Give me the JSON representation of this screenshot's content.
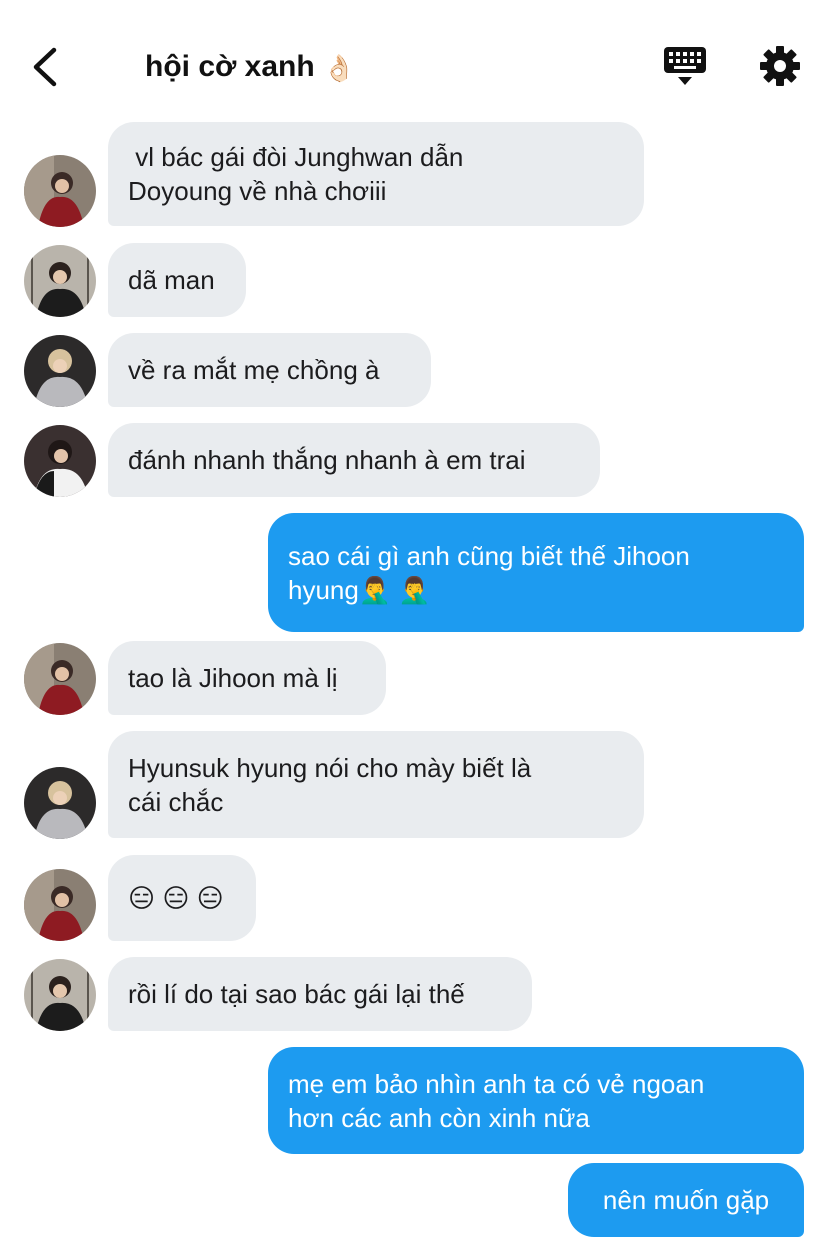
{
  "header": {
    "title": "hội cờ xanh",
    "title_emoji": "👌🏻"
  },
  "messages": [
    {
      "side": "in",
      "avatar": "avatar-red-jacket",
      "text": " vl bác gái đòi Junghwan dẫn\nDoyoung về nhà chơiii"
    },
    {
      "side": "in",
      "avatar": "avatar-black-jacket",
      "text": "dã man"
    },
    {
      "side": "in",
      "avatar": "avatar-grey-hoodie",
      "text": "về ra mắt mẹ chồng à"
    },
    {
      "side": "in",
      "avatar": "avatar-black-white-jacket",
      "text": "đánh nhanh thắng nhanh à em trai"
    },
    {
      "side": "out",
      "text": "sao cái gì anh cũng biết thế Jihoon\nhyung🤦‍♂️ 🤦‍♂️"
    },
    {
      "side": "in",
      "avatar": "avatar-red-jacket",
      "text": "tao là Jihoon mà lị"
    },
    {
      "side": "in",
      "avatar": "avatar-grey-hoodie",
      "text": "Hyunsuk hyung nói cho mày biết là\ncái chắc"
    },
    {
      "side": "in",
      "avatar": "avatar-red-jacket",
      "text": "😑 😑 😑"
    },
    {
      "side": "in",
      "avatar": "avatar-black-jacket",
      "text": "rồi lí do tại sao bác gái lại thế"
    },
    {
      "side": "out",
      "text": "mẹ em bảo nhìn anh ta có vẻ ngoan\nhơn các anh còn xinh nữa"
    },
    {
      "side": "out",
      "text": "nên muốn gặp"
    }
  ],
  "colors": {
    "incoming_bubble": "#e9ecef",
    "outgoing_bubble": "#1d9bf0"
  }
}
